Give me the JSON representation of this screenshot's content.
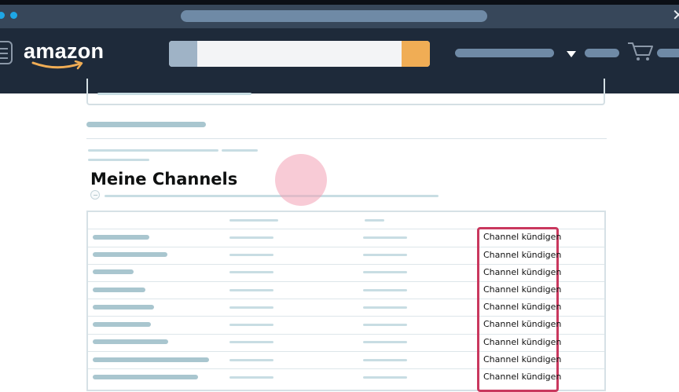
{
  "header": {
    "logo_text": "amazon",
    "search": {
      "value": "",
      "placeholder": ""
    }
  },
  "main": {
    "page_title": "Meine Channels",
    "rows": [
      {
        "action_label": "Channel kündigen"
      },
      {
        "action_label": "Channel kündigen"
      },
      {
        "action_label": "Channel kündigen"
      },
      {
        "action_label": "Channel kündigen"
      },
      {
        "action_label": "Channel kündigen"
      },
      {
        "action_label": "Channel kündigen"
      },
      {
        "action_label": "Channel kündigen"
      },
      {
        "action_label": "Channel kündigen"
      },
      {
        "action_label": "Channel kündigen"
      }
    ]
  },
  "colors": {
    "nav_background": "#1e2a3a",
    "search_button": "#f0ad55",
    "highlight_border": "#c9385e",
    "placeholder_bar": "#a9c6cf"
  }
}
